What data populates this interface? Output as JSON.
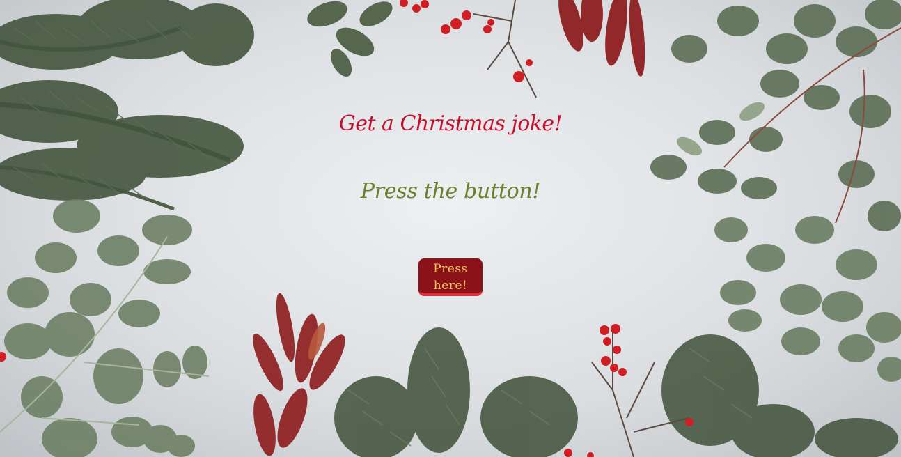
{
  "page": {
    "heading": "Get a Christmas joke!",
    "prompt": "Press the button!"
  },
  "button": {
    "label": "Press here!"
  },
  "colors": {
    "heading": "#c8102e",
    "prompt": "#6b7f2a",
    "button_bg": "#8b1219",
    "button_border": "#e0303c",
    "button_text": "#f2c25a",
    "background": "#e1e3e6",
    "pine": "#4f5e48",
    "eucalyptus": "#7f9176",
    "berry": "#d11d24",
    "protea": "#8e1f20"
  },
  "decorations": [
    "pine-branch",
    "eucalyptus-branch",
    "red-berries",
    "protea-flower"
  ]
}
